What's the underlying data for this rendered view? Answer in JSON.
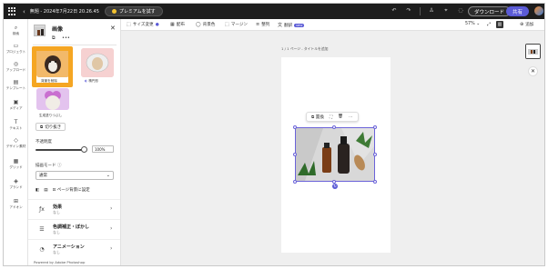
{
  "topbar": {
    "title": "無題 - 2024年7月22日 20.26.45",
    "premium_label": "プレミアムを試す",
    "download_label": "ダウンロード",
    "share_label": "共有"
  },
  "rail": {
    "items": [
      {
        "label": "検索",
        "icon": "search-icon"
      },
      {
        "label": "プロジェクト",
        "icon": "folder-icon"
      },
      {
        "label": "アップロード",
        "icon": "upload-icon"
      },
      {
        "label": "テンプレート",
        "icon": "template-icon"
      },
      {
        "label": "メディア",
        "icon": "media-icon"
      },
      {
        "label": "テキスト",
        "icon": "text-icon"
      },
      {
        "label": "デザイン素材",
        "icon": "shapes-icon"
      },
      {
        "label": "グリッド",
        "icon": "grid-icon"
      },
      {
        "label": "ブランド",
        "icon": "brand-icon"
      },
      {
        "label": "アドオン",
        "icon": "addon-icon"
      }
    ]
  },
  "panel": {
    "title": "画像",
    "effects": {
      "remove_bg": "背景を削除",
      "crop_shape": "楕円形",
      "brush_fill": "生成塗りつぶし"
    },
    "crop_button": "切り抜き",
    "opacity_label": "不透明度",
    "opacity_value": "100%",
    "opacity_fraction": 1.0,
    "blend_label": "描画モード",
    "blend_value": "通常",
    "set_background": "ページ背景に設定",
    "menu": [
      {
        "title": "効果",
        "sub": "なし"
      },
      {
        "title": "色調補正・ぼかし",
        "sub": "なし"
      },
      {
        "title": "アニメーション",
        "sub": "なし"
      }
    ],
    "powered_by": "Powered by Adobe Photoshop"
  },
  "toolbar": {
    "resize": "サイズ変更",
    "layout": "配布",
    "background": "背景色",
    "margin": "マージン",
    "organize": "整列",
    "translate": "翻訳",
    "new_badge": "NEW",
    "zoom": "57%",
    "add": "追加"
  },
  "canvas": {
    "page_label": "1 / 1 ページ - タイトルを追加",
    "ctx": {
      "replace": "置換",
      "crop_icon": "crop-icon",
      "delete_icon": "trash-icon",
      "more": "…"
    }
  },
  "colors": {
    "accent": "#5b5bd6",
    "highlight": "#f5a623",
    "topbar_bg": "#1d1d1d"
  }
}
